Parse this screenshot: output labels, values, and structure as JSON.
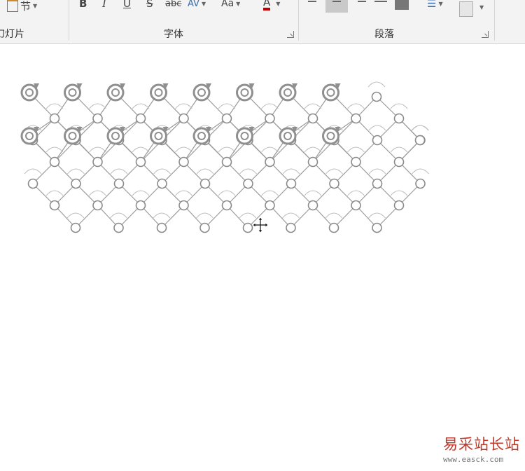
{
  "ribbon": {
    "section_button": "节",
    "slide_group_label": "幻灯片",
    "font_group_label": "字体",
    "paragraph_group_label": "段落",
    "bold": "B",
    "italic": "I",
    "underline": "U",
    "strike": "S",
    "abc": "abc",
    "spacing": "AV",
    "case": "Aa",
    "font_color": "A",
    "font_color_value": "#c00000"
  },
  "watermark": {
    "name": "易采站长站",
    "url": "www.easck.com"
  }
}
